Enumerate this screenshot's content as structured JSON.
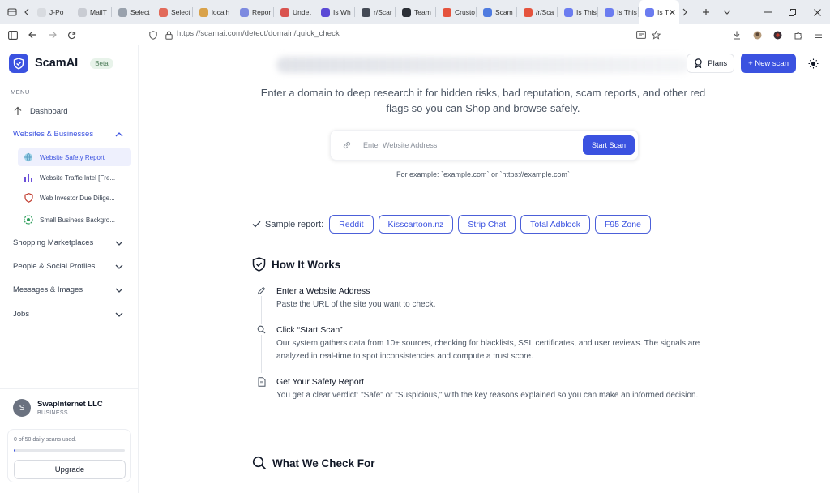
{
  "browser": {
    "tabs": [
      {
        "label": "J-Po",
        "color": "#d8dbe0"
      },
      {
        "label": "MailT",
        "color": "#c9ccd3"
      },
      {
        "label": "Select",
        "color": "#9aa2ad"
      },
      {
        "label": "Select",
        "color": "#e26a5a"
      },
      {
        "label": "localh",
        "color": "#d9a24a"
      },
      {
        "label": "Repor",
        "color": "#7d8ae0"
      },
      {
        "label": "Undet",
        "color": "#d9534f"
      },
      {
        "label": "Is Wh",
        "color": "#5b4ad6"
      },
      {
        "label": "r/Scar",
        "color": "#444a55"
      },
      {
        "label": "Team",
        "color": "#2b2f36"
      },
      {
        "label": "Crusto",
        "color": "#e5533d"
      },
      {
        "label": "Scam",
        "color": "#4f7be0"
      },
      {
        "label": "/r/Sca",
        "color": "#e5533d"
      },
      {
        "label": "Is This",
        "color": "#6b7cf0"
      },
      {
        "label": "Is This",
        "color": "#6b7cf0"
      },
      {
        "label": "Is T",
        "color": "#6b7cf0"
      }
    ],
    "url": "https://scamai.com/detect/domain/quick_check"
  },
  "sidebar": {
    "brand": "ScamAI",
    "badge": "Beta",
    "menu_label": "MENU",
    "dashboard": "Dashboard",
    "websites_section": "Websites & Businesses",
    "sub_items": [
      "Website Safety Report",
      "Website Traffic Intel [Fre...",
      "Web Investor Due Dilige...",
      "Small Business Backgro..."
    ],
    "sections": [
      "Shopping Marketplaces",
      "People & Social Profiles",
      "Messages & Images",
      "Jobs"
    ],
    "user": {
      "initial": "S",
      "name": "SwapInternet LLC",
      "type": "BUSINESS"
    },
    "usage": {
      "text": "0 of 50 daily scans used.",
      "used": 0,
      "limit": 50
    },
    "upgrade_label": "Upgrade"
  },
  "header": {
    "plans_label": "Plans",
    "new_scan_label": "+ New scan"
  },
  "hero": {
    "description": "Enter a domain to deep research it for hidden risks, bad reputation, scam reports, and other red flags so you can Shop and browse safely.",
    "input_placeholder": "Enter Website Address",
    "start_label": "Start Scan",
    "example": "For example: `example.com` or `https://example.com`"
  },
  "samples": {
    "label": "Sample report:",
    "chips": [
      "Reddit",
      "Kisscartoon.nz",
      "Strip Chat",
      "Total Adblock",
      "F95 Zone"
    ]
  },
  "how_it_works": {
    "title": "How It Works",
    "steps": [
      {
        "title": "Enter a Website Address",
        "desc": "Paste the URL of the site you want to check."
      },
      {
        "title": "Click “Start Scan”",
        "desc": "Our system gathers data from 10+ sources, checking for blacklists, SSL certificates, and user reviews. The signals are analyzed in real-time to spot inconsistencies and compute a trust score."
      },
      {
        "title": "Get Your Safety Report",
        "desc": "You get a clear verdict: \"Safe\" or \"Suspicious,\" with the key reasons explained so you can make an informed decision."
      }
    ]
  },
  "what_we_check": {
    "title": "What We Check For"
  },
  "colors": {
    "accent": "#3b52e0"
  }
}
